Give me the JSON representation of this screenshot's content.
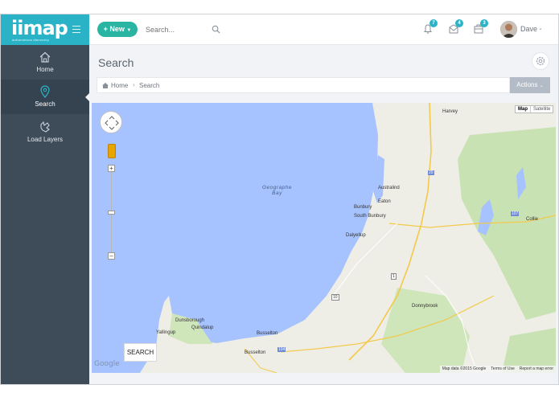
{
  "app": {
    "logo_text": "iimap",
    "logo_tagline": "autonomous discovery"
  },
  "header": {
    "new_label": "New",
    "search_placeholder": "Search...",
    "notifications": [
      {
        "name": "bell",
        "count": "7"
      },
      {
        "name": "inbox",
        "count": "4"
      },
      {
        "name": "tasks",
        "count": "3"
      }
    ],
    "username": "Dave"
  },
  "sidebar": {
    "items": [
      {
        "label": "Home",
        "icon": "home-icon"
      },
      {
        "label": "Search",
        "icon": "map-pin-icon",
        "active": true
      },
      {
        "label": "Load Layers",
        "icon": "layers-icon"
      }
    ]
  },
  "page": {
    "title": "Search",
    "breadcrumb": [
      "Home",
      "Search"
    ],
    "actions_label": "Actions"
  },
  "map": {
    "type_options": [
      "Map",
      "Satellite"
    ],
    "selected_type": "Map",
    "search_button": "SEARCH",
    "provider": "Google",
    "attribution": [
      "Map data ©2015 Google",
      "Terms of Use",
      "Report a map error"
    ],
    "sea_label": [
      "Geographe",
      "Bay"
    ],
    "places": [
      "Harvey",
      "Australind",
      "Eaton",
      "Bunbury",
      "South Bunbury",
      "Dalyellup",
      "Collie",
      "Donnybrook",
      "Dunsborough",
      "Quindalup",
      "Yallingup",
      "Busselton",
      "Busselton"
    ],
    "road_shields": [
      "20",
      "107",
      "1",
      "10",
      "104"
    ],
    "colors": {
      "water": "#a6c3ff",
      "land": "#efeee6",
      "forest": "#c9e2b3"
    }
  }
}
